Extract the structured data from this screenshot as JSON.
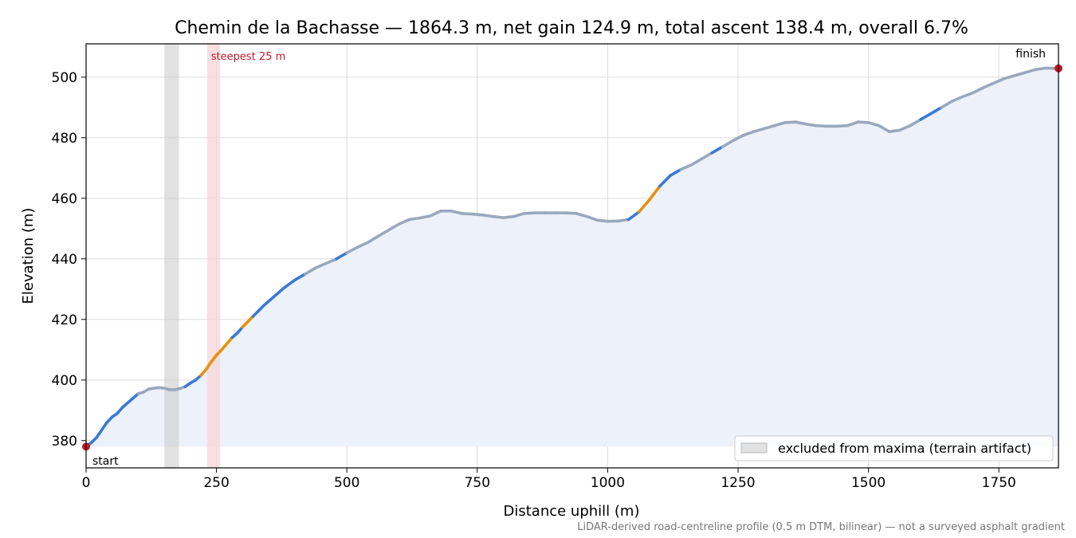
{
  "chart_data": {
    "type": "area",
    "title": "Chemin de la Bachasse — 1864.3 m, net gain 124.9 m, total ascent 138.4 m, overall 6.7%",
    "xlabel": "Distance uphill (m)",
    "ylabel": "Elevation (m)",
    "xlim": [
      0,
      1864.3
    ],
    "ylim": [
      371,
      511
    ],
    "xticks": [
      0,
      250,
      500,
      750,
      1000,
      1250,
      1500,
      1750
    ],
    "yticks": [
      380,
      400,
      420,
      440,
      460,
      480,
      500
    ],
    "grid": true,
    "legend": {
      "placement": "lower-right",
      "label": "excluded from maxima (terrain artifact)"
    },
    "footnote": "LiDAR-derived road-centreline profile (0.5 m DTM, bilinear) — not a surveyed asphalt gradient",
    "colors": {
      "fill": "#ecf1fa",
      "gentle": "#9aa8bc",
      "moderate": "#3a78d6",
      "steep": "#e8900c",
      "marker": "#c0182a",
      "excluded": "#e3e3e3",
      "steepest": "#f7d7db",
      "grid": "#dddddd"
    },
    "excluded_band": [
      150,
      178
    ],
    "steepest_band": {
      "x": [
        232,
        257
      ],
      "label": "steepest 25 m"
    },
    "markers": [
      {
        "label": "start",
        "x": 0,
        "y": 378
      },
      {
        "label": "finish",
        "x": 1864.3,
        "y": 502.9
      }
    ],
    "profile": {
      "x": [
        0,
        10,
        20,
        30,
        40,
        50,
        60,
        70,
        80,
        90,
        100,
        110,
        120,
        130,
        140,
        150,
        160,
        170,
        180,
        190,
        200,
        210,
        220,
        230,
        240,
        250,
        260,
        270,
        280,
        290,
        300,
        320,
        340,
        360,
        380,
        400,
        420,
        440,
        460,
        480,
        500,
        520,
        540,
        560,
        580,
        600,
        620,
        640,
        660,
        680,
        700,
        720,
        740,
        760,
        780,
        800,
        820,
        840,
        860,
        880,
        900,
        920,
        940,
        960,
        980,
        1000,
        1020,
        1040,
        1060,
        1080,
        1100,
        1120,
        1140,
        1160,
        1180,
        1200,
        1220,
        1240,
        1260,
        1280,
        1300,
        1320,
        1340,
        1360,
        1380,
        1400,
        1420,
        1440,
        1460,
        1480,
        1500,
        1520,
        1540,
        1560,
        1580,
        1600,
        1620,
        1640,
        1660,
        1680,
        1700,
        1720,
        1740,
        1760,
        1780,
        1800,
        1820,
        1840,
        1864.3
      ],
      "y": [
        378,
        379.3,
        381,
        383.5,
        386,
        387.8,
        389,
        391,
        392.5,
        394,
        395.5,
        396,
        397,
        397.3,
        397.5,
        397.3,
        396.8,
        396.8,
        397.2,
        397.8,
        399,
        400,
        401.5,
        403.5,
        406,
        408.2,
        410,
        412,
        414,
        415.5,
        417.5,
        421,
        424.5,
        427.5,
        430.5,
        433,
        435,
        437,
        438.5,
        440,
        442,
        443.8,
        445.4,
        447.5,
        449.5,
        451.5,
        453,
        453.5,
        454.2,
        455.8,
        455.8,
        455,
        454.8,
        454.5,
        454,
        453.6,
        454,
        455,
        455.2,
        455.2,
        455.2,
        455.2,
        455,
        454,
        452.8,
        452.4,
        452.5,
        453,
        455.5,
        459.5,
        464,
        467.5,
        469.5,
        471,
        473,
        475,
        477,
        479,
        480.8,
        482,
        483,
        484,
        485,
        485.2,
        484.5,
        484,
        483.8,
        483.8,
        484,
        485.2,
        485,
        484,
        482,
        482.5,
        484,
        486,
        488,
        490,
        492,
        493.5,
        494.8,
        496.5,
        498,
        499.5,
        500.5,
        501.5,
        502.5,
        503,
        502.9
      ],
      "gradient_class": [
        "moderate",
        "moderate",
        "moderate",
        "moderate",
        "moderate",
        "moderate",
        "moderate",
        "moderate",
        "moderate",
        "moderate",
        "gentle",
        "gentle",
        "gentle",
        "gentle",
        "gentle",
        "gentle",
        "gentle",
        "gentle",
        "gentle",
        "moderate",
        "moderate",
        "moderate",
        "steep",
        "steep",
        "steep",
        "steep",
        "steep",
        "steep",
        "moderate",
        "moderate",
        "steep",
        "moderate",
        "moderate",
        "moderate",
        "moderate",
        "moderate",
        "gentle",
        "gentle",
        "gentle",
        "moderate",
        "gentle",
        "gentle",
        "gentle",
        "gentle",
        "gentle",
        "gentle",
        "gentle",
        "gentle",
        "gentle",
        "gentle",
        "gentle",
        "gentle",
        "gentle",
        "gentle",
        "gentle",
        "gentle",
        "gentle",
        "gentle",
        "gentle",
        "gentle",
        "gentle",
        "gentle",
        "gentle",
        "gentle",
        "gentle",
        "gentle",
        "gentle",
        "moderate",
        "steep",
        "steep",
        "moderate",
        "moderate",
        "gentle",
        "gentle",
        "gentle",
        "moderate",
        "gentle",
        "gentle",
        "gentle",
        "gentle",
        "gentle",
        "gentle",
        "gentle",
        "gentle",
        "gentle",
        "gentle",
        "gentle",
        "gentle",
        "gentle",
        "gentle",
        "gentle",
        "gentle",
        "gentle",
        "gentle",
        "gentle",
        "moderate",
        "moderate",
        "gentle",
        "gentle",
        "gentle",
        "gentle",
        "gentle",
        "gentle",
        "gentle",
        "gentle",
        "gentle",
        "gentle",
        "gentle"
      ]
    }
  }
}
